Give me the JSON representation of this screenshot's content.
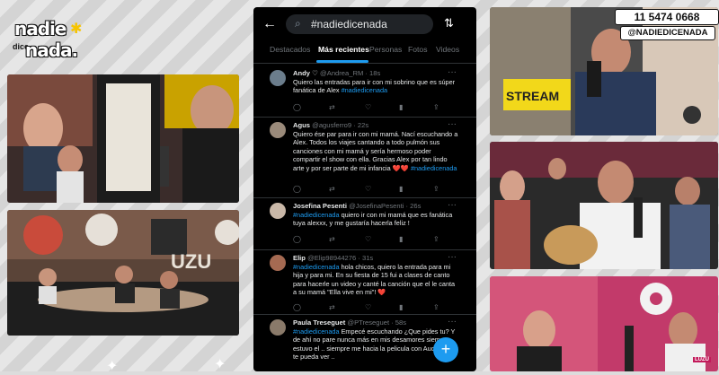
{
  "logo": {
    "line1": "nadie",
    "small": "dice",
    "line2": "nada."
  },
  "badge": {
    "phone": "11 5474 0668",
    "handle": "@NADIEDICENADA"
  },
  "search": {
    "query": "#nadiedicenada"
  },
  "tabs": [
    "Destacados",
    "Más recientes",
    "Personas",
    "Fotos",
    "Videos"
  ],
  "active_tab": "Más recientes",
  "colors": {
    "accent": "#1d9bf0",
    "heart": "#f91880",
    "brand_yellow": "#f6c400"
  },
  "tweets": [
    {
      "name": "Andy",
      "handle": "@Andrea_RM · 18s",
      "text": "Quiero las entradas para ir con mi sobrino que es súper fanática de Alex",
      "tag": "#nadiedicenada"
    },
    {
      "name": "Agus",
      "handle": "@agusferro9 · 22s",
      "text": "Quiero ése par para ir con mi mamá. Nací escuchando a Alex. Todos los viajes cantando a todo pulmón sus canciones con mi mamá y sería hermoso poder compartir el show con ella. Gracias Alex por tan lindo arte y por ser parte de mi infancia ❤️❤️",
      "tag": "#nadiedicenada"
    },
    {
      "name": "Josefina Pesenti",
      "handle": "@JosefinaPesenti · 26s",
      "tag": "#nadiedicenada",
      "text": "quiero ir con mi mamá que es fanática tuya alexxx, y me gustaría hacerla feliz !"
    },
    {
      "name": "Elip",
      "handle": "@Elip98944276 · 31s",
      "text": "hola chicos, quiero la entrada para mi hija y para mi. En su fiesta de 15 fui a clases de canto para hacerle un video y canté la canción que el le canta a su mamá \"Ella vive en mi\"! ❤️",
      "tag": "#nadiedicenada"
    },
    {
      "name": "Paula Treseguet",
      "handle": "@PTreseguet · 58s",
      "tag": "#nadiedicenada",
      "text": "Empecé escuchando ¿Que pides tu? Y de ahí no pare nunca más en mis desamores siempre estuvo el .. siempre me hacia la pelicula con Audolie no te pueda ver .."
    }
  ],
  "watermark": "LUZU"
}
